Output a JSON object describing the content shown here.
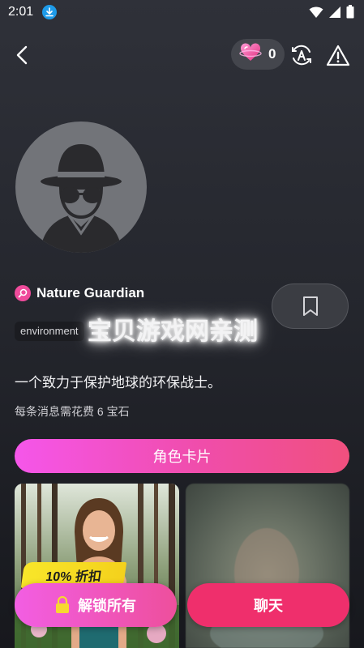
{
  "status": {
    "time": "2:01"
  },
  "header": {
    "gem_count": "0"
  },
  "profile": {
    "name": "Nature Guardian",
    "tag": "environment",
    "description": "一个致力于保护地球的环保战士。",
    "cost_note": "每条消息需花费 6 宝石"
  },
  "watermark": "宝贝游戏网亲测",
  "actions": {
    "character_card": "角色卡片",
    "discount": "10% 折扣",
    "unlock_all": "解锁所有",
    "chat": "聊天"
  },
  "icons": {
    "download": "download-icon",
    "wifi": "wifi-icon",
    "signal": "signal-icon",
    "battery": "battery-icon",
    "back": "back-arrow-icon",
    "gem": "heart-gem-icon",
    "translate": "translate-icon",
    "report": "warning-icon",
    "bookmark": "bookmark-icon",
    "lock": "lock-icon"
  },
  "colors": {
    "accent_pink": "#ef2f6c",
    "gradient_start": "#f556ea",
    "discount_yellow": "#f8e62a"
  }
}
